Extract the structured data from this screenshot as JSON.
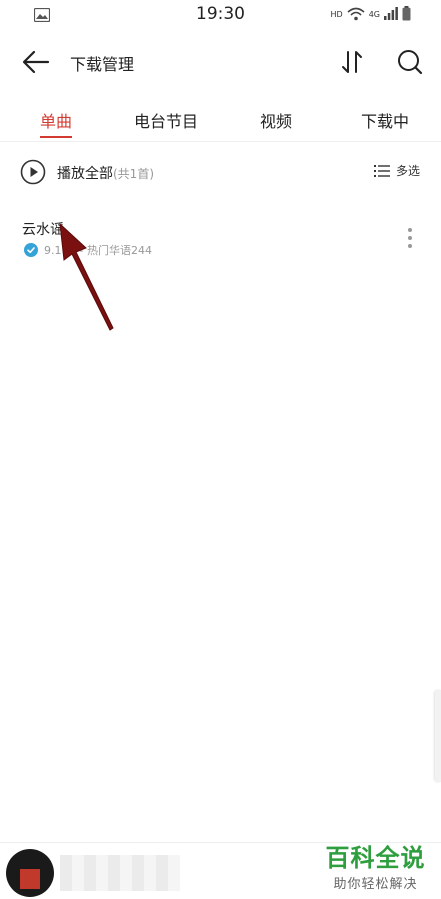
{
  "status_bar": {
    "time": "19:30",
    "network": "HD",
    "signal": "4G"
  },
  "header": {
    "title": "下载管理"
  },
  "tabs": [
    {
      "label": "单曲",
      "active": true
    },
    {
      "label": "电台节目",
      "active": false
    },
    {
      "label": "视频",
      "active": false
    },
    {
      "label": "下载中",
      "active": false
    }
  ],
  "play_all": {
    "label": "播放全部",
    "count": "(共1首)"
  },
  "multi_select": {
    "label": "多选"
  },
  "songs": [
    {
      "title": "云水谣",
      "subtitle": "9.1 桑 - 热门华语244"
    }
  ],
  "watermark": {
    "title": "百科全说",
    "subtitle": "助你轻松解决"
  },
  "colors": {
    "accent": "#d33a31",
    "downloaded_badge": "#35a3d8",
    "watermark_green": "#2e9e3e",
    "annotation_arrow": "#7a1010"
  }
}
